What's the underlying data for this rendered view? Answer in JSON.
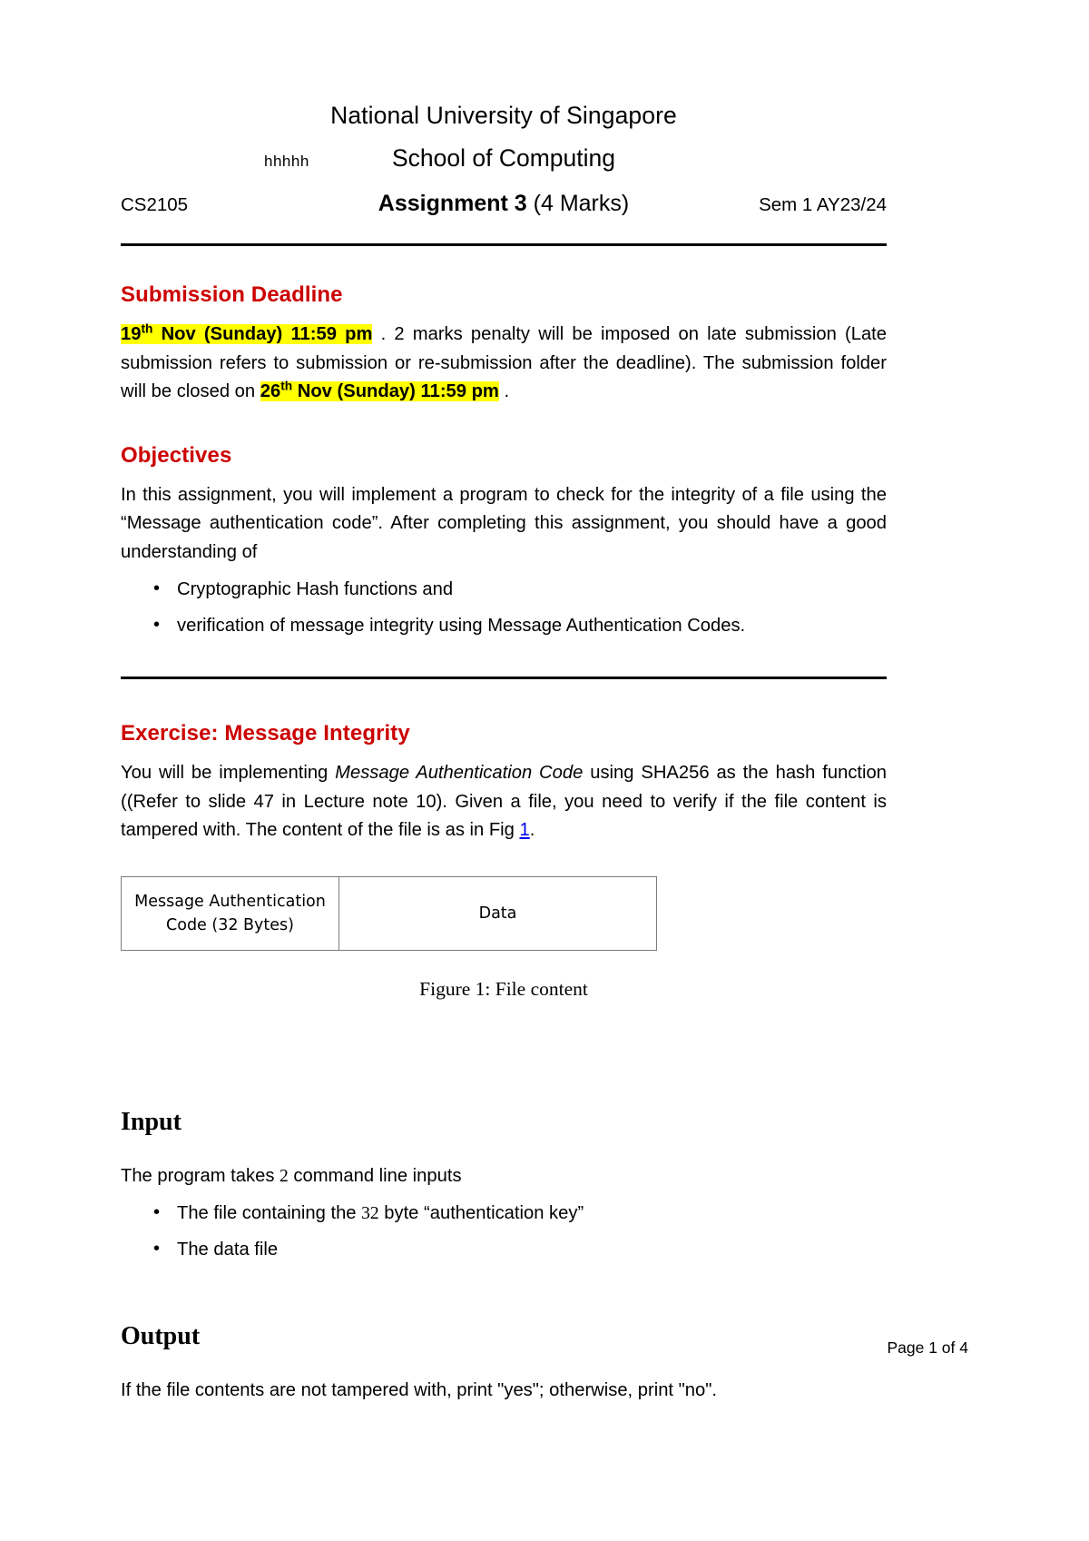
{
  "header": {
    "university": "National University of Singapore",
    "school": "School of Computing",
    "stray_note": "hhhhh",
    "course_code": "CS2105",
    "title_bold": "Assignment 3",
    "title_marks": "(4 Marks)",
    "semester": "Sem 1 AY23/24"
  },
  "submission": {
    "heading": "Submission Deadline",
    "deadline_highlight": "19",
    "deadline_highlight_sup": "th",
    "deadline_highlight_rest": " Nov (Sunday) 11:59 pm",
    "text_after_first": ". 2 marks penalty will be imposed on late submission (Late submission refers to submission or re-submission after the deadline). The submission folder will be closed on",
    "close_highlight": "26",
    "close_highlight_sup": "th",
    "close_highlight_rest": " Nov (Sunday) 11:59 pm",
    "text_end": "."
  },
  "objectives": {
    "heading": "Objectives",
    "paragraph": "In this assignment, you will implement a program to check for the integrity of a file using the “Message authentication code”. After completing this assignment, you should have a good understanding of",
    "bullets": [
      "Cryptographic Hash functions and",
      "verification of message integrity using Message Authentication Codes."
    ]
  },
  "exercise": {
    "heading": "Exercise: Message Integrity",
    "para_part1": "You will be implementing ",
    "para_italic": "Message Authentication Code",
    "para_part2": " using SHA256 as the hash function ((Refer to slide 47 in Lecture note 10). Given a file, you need to verify if the file content is tampered with. The content of the file is as in Fig ",
    "para_fig_link": "1",
    "para_part3": "."
  },
  "figure": {
    "cell_mac_line1": "Message Authentication",
    "cell_mac_line2": "Code (32 Bytes)",
    "cell_data": "Data",
    "caption": "Figure 1: File content"
  },
  "input": {
    "heading": "Input",
    "para_part1": "The program takes ",
    "para_num": "2",
    "para_part2": " command line inputs",
    "bullet1_part1": "The file containing the ",
    "bullet1_num": "32",
    "bullet1_part2": " byte “authentication key”",
    "bullet2": "The data file"
  },
  "output": {
    "heading": "Output",
    "paragraph": "If the file contents are not tampered with, print \"yes\"; otherwise, print \"no\"."
  },
  "footer": {
    "page_label": "Page 1 of 4"
  },
  "colors": {
    "heading_red": "#cc0000",
    "highlight_yellow": "#ffff00",
    "link_blue": "#0000ee"
  }
}
